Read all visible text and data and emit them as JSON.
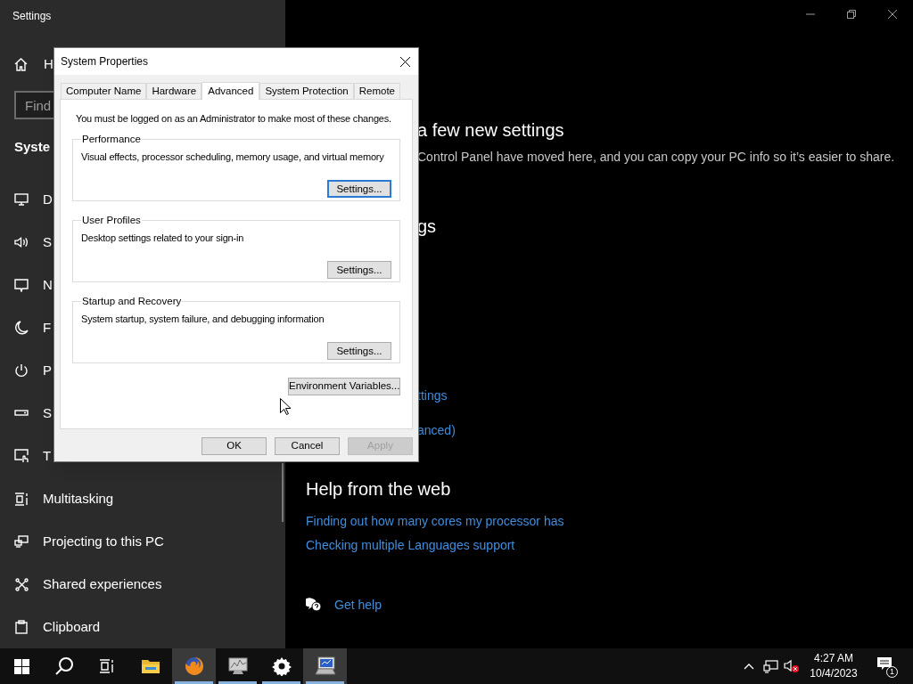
{
  "settings_window": {
    "title": "Settings",
    "sidebar": {
      "home": "H",
      "search": {
        "placeholder": "Find"
      },
      "heading": "Syste",
      "items": [
        {
          "label": "D"
        },
        {
          "label": "S"
        },
        {
          "label": "N"
        },
        {
          "label": "F"
        },
        {
          "label": "P"
        },
        {
          "label": "S"
        },
        {
          "label": "T"
        },
        {
          "label": "Multitasking"
        },
        {
          "label": "Projecting to this PC"
        },
        {
          "label": "Shared experiences"
        },
        {
          "label": "Clipboard"
        }
      ]
    },
    "main": {
      "items": [
        {
          "kind": "heading",
          "text": "a few new settings"
        },
        {
          "kind": "text",
          "text": "Control Panel have moved here, and you can copy your PC info so it’s easier to share."
        },
        {
          "kind": "heading",
          "text": "gs"
        },
        {
          "kind": "link",
          "text": "ttings"
        },
        {
          "kind": "link",
          "text": "anced)"
        },
        {
          "kind": "heading",
          "text": "Help from the web"
        },
        {
          "kind": "link",
          "text": "Finding out how many cores my processor has"
        },
        {
          "kind": "link",
          "text": "Checking multiple Languages support"
        },
        {
          "kind": "help",
          "text": "Get help"
        }
      ]
    }
  },
  "dialog": {
    "title": "System Properties",
    "tabs": [
      {
        "label": "Computer Name",
        "selected": false
      },
      {
        "label": "Hardware",
        "selected": false
      },
      {
        "label": "Advanced",
        "selected": true
      },
      {
        "label": "System Protection",
        "selected": false
      },
      {
        "label": "Remote",
        "selected": false
      }
    ],
    "notice": "You must be logged on as an Administrator to make most of these changes.",
    "groups": [
      {
        "title": "Performance",
        "description": "Visual effects, processor scheduling, memory usage, and virtual memory",
        "button": {
          "label": "Settings...",
          "focused": true
        }
      },
      {
        "title": "User Profiles",
        "description": "Desktop settings related to your sign-in",
        "button": {
          "label": "Settings...",
          "focused": false
        }
      },
      {
        "title": "Startup and Recovery",
        "description": "System startup, system failure, and debugging information",
        "button": {
          "label": "Settings...",
          "focused": false
        }
      }
    ],
    "env_button": "Environment Variables...",
    "buttons": [
      {
        "label": "OK",
        "disabled": false
      },
      {
        "label": "Cancel",
        "disabled": false
      },
      {
        "label": "Apply",
        "disabled": true
      }
    ]
  },
  "taskbar": {
    "apps": [
      {
        "running": false,
        "active": false
      },
      {
        "running": true,
        "active": true
      },
      {
        "running": true,
        "active": false
      },
      {
        "running": true,
        "active": false
      },
      {
        "running": true,
        "active": true
      }
    ],
    "time": "4:27 AM",
    "date": "10/4/2023",
    "notifications": "1"
  }
}
